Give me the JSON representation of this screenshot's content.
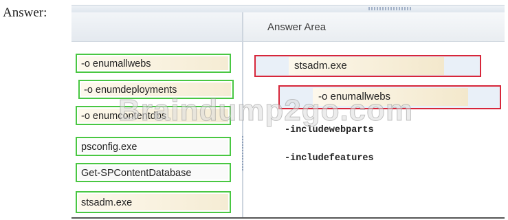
{
  "answer_label": "Answer:",
  "panel": {
    "answer_area_title": "Answer Area"
  },
  "source_items": [
    "-o enumallwebs",
    "-o enumdeployments",
    "-o enumcontentdbs",
    "psconfig.exe",
    "Get-SPContentDatabase",
    "stsadm.exe"
  ],
  "answer_slots": [
    "stsadm.exe",
    "-o enumallwebs"
  ],
  "static_params": [
    "-includewebparts",
    "-includefeatures"
  ],
  "watermark": "Braindump2go.com",
  "colors": {
    "source_border": "#49c742",
    "target_border": "#d7263a",
    "chip_fill": "#fdf8ec"
  }
}
